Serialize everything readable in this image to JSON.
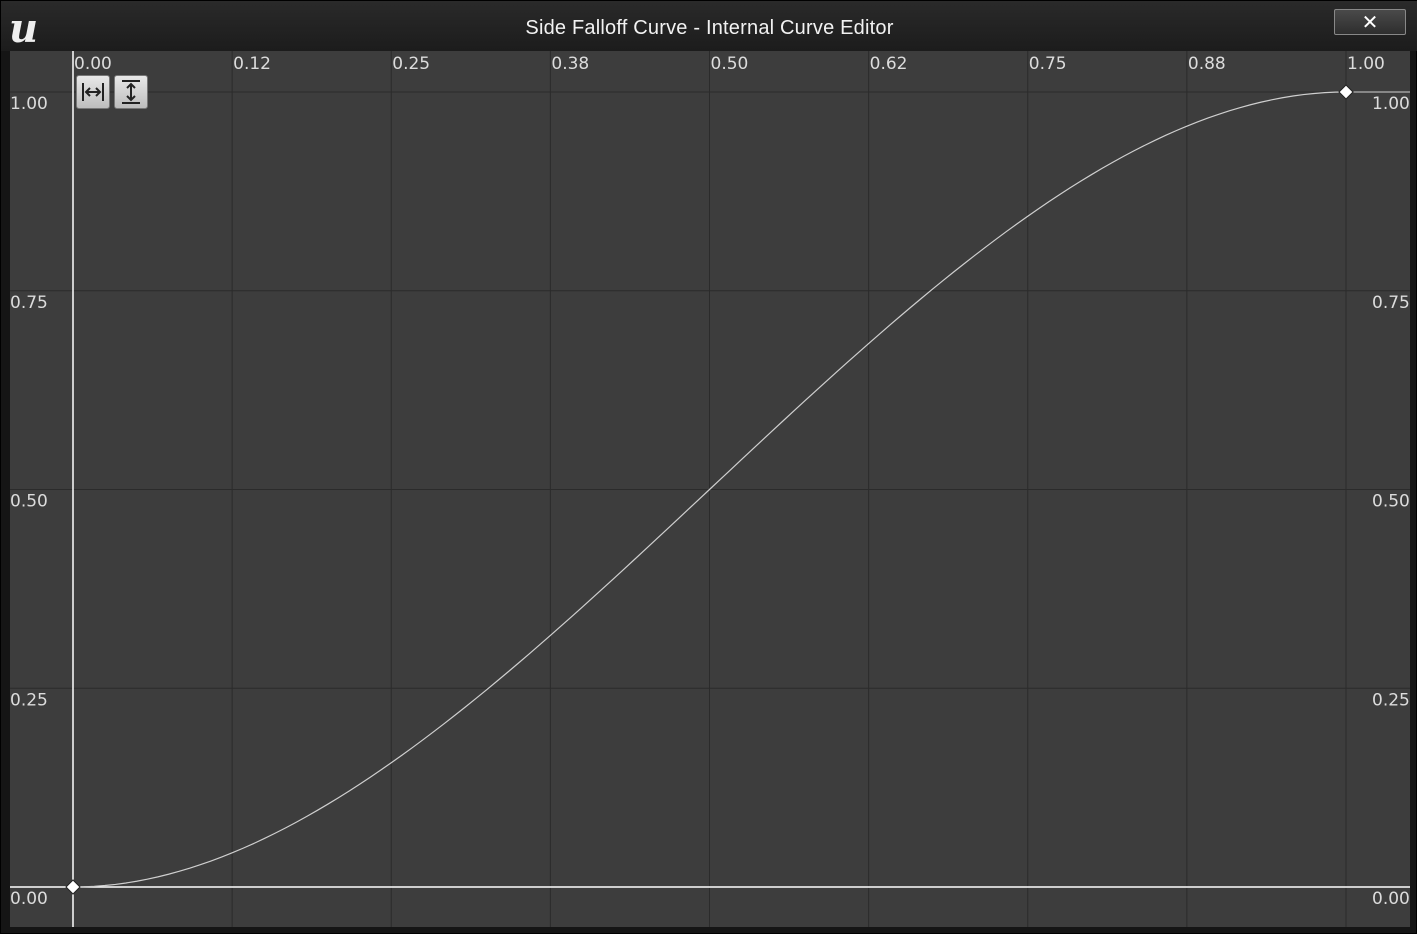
{
  "window": {
    "title": "Side Falloff Curve - Internal Curve Editor",
    "logo": "u",
    "close_icon": "close-icon"
  },
  "toolbar": {
    "fit_horizontal_icon": "fit-horizontal-icon",
    "fit_vertical_icon": "fit-vertical-icon"
  },
  "chart_data": {
    "type": "line",
    "x_ticks": [
      "0.00",
      "0.12",
      "0.25",
      "0.38",
      "0.50",
      "0.62",
      "0.75",
      "0.88",
      "1.00"
    ],
    "x_tick_values": [
      0,
      0.125,
      0.25,
      0.375,
      0.5,
      0.625,
      0.75,
      0.875,
      1.0
    ],
    "y_ticks": [
      "1.00",
      "0.75",
      "0.50",
      "0.25",
      "0.00"
    ],
    "y_tick_values": [
      1.0,
      0.75,
      0.5,
      0.25,
      0.0
    ],
    "xlim": [
      0,
      1.0
    ],
    "ylim": [
      0,
      1.0
    ],
    "grid": true,
    "series": [
      {
        "interpolation": "cubic ease-in-out",
        "keys": [
          {
            "x": 0.0,
            "y": 0.0
          },
          {
            "x": 1.0,
            "y": 1.0
          }
        ]
      }
    ],
    "colors": {
      "background": "#3d3d3d",
      "grid": "#2b2b2b",
      "curve": "#cfcfcf",
      "axis": "#ffffff"
    }
  }
}
